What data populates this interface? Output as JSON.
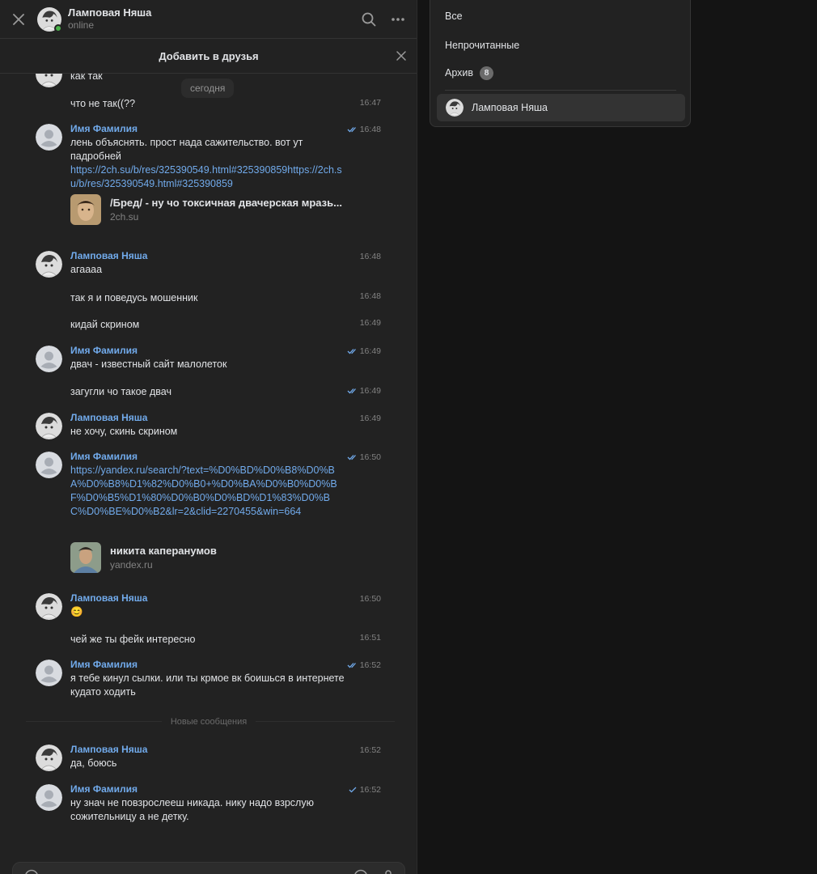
{
  "header": {
    "contact_name": "Ламповая Няша",
    "status": "online",
    "search_icon": "search-icon",
    "more_icon": "more-horizontal-icon",
    "close_icon": "close-icon"
  },
  "add_friend_bar": {
    "label": "Добавить в друзья"
  },
  "date_separator": "сегодня",
  "messages": [
    {
      "text": "как так"
    },
    {
      "text": "что не так((??",
      "time": "16:47"
    },
    {
      "author": "Имя Фамилия",
      "time": "16:48",
      "text": "лень объяснять. прост нада сажительство. вот ут падробней",
      "link": "https://2ch.su/b/res/325390549.html#325390859https://2ch.su/b/res/325390549.html#325390859",
      "snippet": {
        "title": "/Бред/ - ну чо токсичная двачерская мразь...",
        "domain": "2ch.su"
      }
    },
    {
      "author": "Ламповая Няша",
      "time": "16:48",
      "text": "агаааа"
    },
    {
      "text": "так я и поведусь мошенник",
      "time": "16:48"
    },
    {
      "text": "кидай скрином",
      "time": "16:49"
    },
    {
      "author": "Имя Фамилия",
      "time": "16:49",
      "text": "двач - известный сайт малолеток"
    },
    {
      "text": "загугли чо такое двач",
      "time": "16:49"
    },
    {
      "author": "Ламповая Няша",
      "time": "16:49",
      "text": "не хочу, скинь скрином"
    },
    {
      "author": "Имя Фамилия",
      "time": "16:50",
      "link": "https://yandex.ru/search/?text=%D0%BD%D0%B8%D0%BA%D0%B8%D1%82%D0%B0+%D0%BA%D0%B0%D0%BF%D0%B5%D1%80%D0%B0%D0%BD%D1%83%D0%BC%D0%BE%D0%B2&lr=2&clid=2270455&win=664",
      "snippet": {
        "title": "никита каперанумов",
        "domain": "yandex.ru"
      }
    },
    {
      "author": "Ламповая Няша",
      "time": "16:50",
      "text": "😊"
    },
    {
      "text": "чей же ты фейк интересно",
      "time": "16:51"
    },
    {
      "author": "Имя Фамилия",
      "time": "16:52",
      "text": "я тебе кинул сылки. или ты крмое вк боишься в интернете кудато ходить"
    },
    {
      "author": "Ламповая Няша",
      "time": "16:52",
      "text": "да, боюсь"
    },
    {
      "author": "Имя Фамилия",
      "time": "16:52",
      "text": "ну знач не повзрослееш никада. нику надо взрслую сожительницу а не детку."
    }
  ],
  "new_messages_label": "Новые сообщения",
  "folders_dropdown": {
    "items": [
      {
        "label": "Все"
      },
      {
        "label": "Непрочитанные"
      },
      {
        "label": "Архив",
        "badge": "8"
      }
    ],
    "active_chat": "Ламповая Няша"
  },
  "colors": {
    "accent": "#71aaeb",
    "online": "#4bb34b",
    "background": "#222222"
  }
}
